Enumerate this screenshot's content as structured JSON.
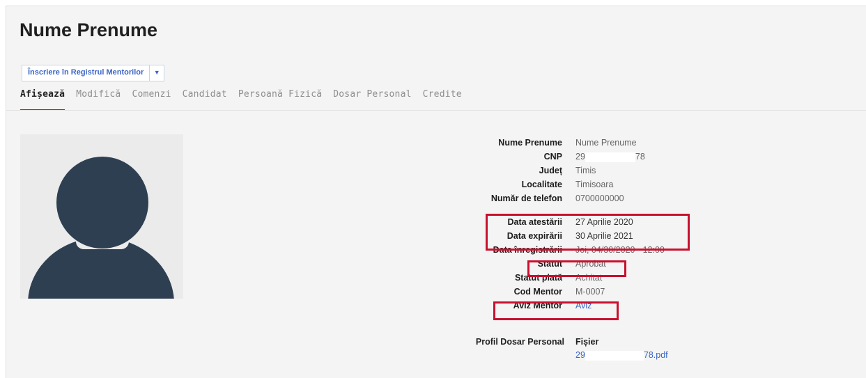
{
  "page_title": "Nume Prenume",
  "action": {
    "label": "Înscriere în Registrul Mentorilor",
    "caret_icon": "caret-down-icon"
  },
  "tabs": [
    "Afișează",
    "Modifică",
    "Comenzi",
    "Candidat",
    "Persoană Fizică",
    "Dosar Personal",
    "Credite"
  ],
  "active_tab": "Afișează",
  "avatar": {
    "icon": "user-placeholder-icon"
  },
  "details": {
    "nume_label": "Nume Prenume",
    "nume_value": "Nume Prenume",
    "cnp_label": "CNP",
    "cnp_prefix": "29",
    "cnp_suffix": "78",
    "judet_label": "Județ",
    "judet_value": "Timis",
    "localitate_label": "Localitate",
    "localitate_value": "Timisoara",
    "telefon_label": "Număr de telefon",
    "telefon_value": "0700000000",
    "atestare_label": "Data atestării",
    "atestare_value": "27 Aprilie 2020",
    "expirare_label": "Data expirării",
    "expirare_value": "30 Aprilie 2021",
    "inregistrare_label": "Data înregistrării",
    "inregistrare_value": "Joi, 04/30/2020 - 12:00",
    "statut_label": "Statut",
    "statut_value": "Aprobat",
    "statut_plata_label": "Statut plată",
    "statut_plata_value": "Achitat",
    "cod_label": "Cod Mentor",
    "cod_value": "M-0007",
    "aviz_label": "Aviz Mentor",
    "aviz_value": "Aviz"
  },
  "file": {
    "label": "Profil Dosar Personal",
    "header": "Fișier",
    "name_prefix": "29",
    "name_suffix": "78.pdf"
  },
  "highlight_color": "#c8102e",
  "link_color": "#3b66c4"
}
